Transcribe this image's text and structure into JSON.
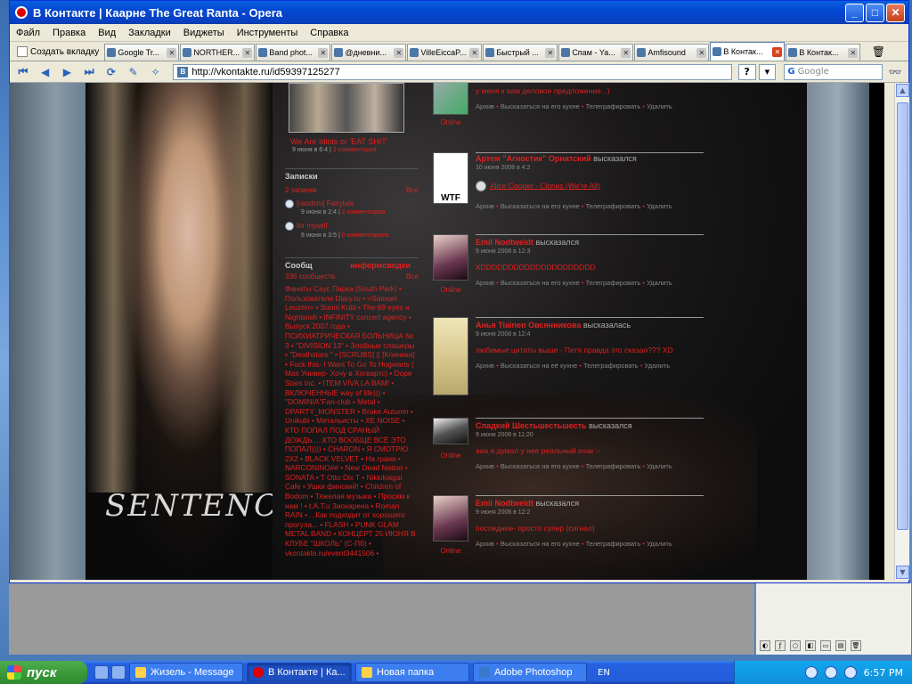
{
  "window": {
    "title": "В Контакте | Каарне The Great Ranta - Opera"
  },
  "menu": [
    "Файл",
    "Правка",
    "Вид",
    "Закладки",
    "Виджеты",
    "Инструменты",
    "Справка"
  ],
  "tabs": {
    "new_tab_label": "Создать вкладку",
    "items": [
      {
        "label": "Google Tr...",
        "active": false
      },
      {
        "label": "NORTHER...",
        "active": false
      },
      {
        "label": "Band phot...",
        "active": false
      },
      {
        "label": "@дневни...",
        "active": false
      },
      {
        "label": "VilleEiccaP...",
        "active": false
      },
      {
        "label": "Быстрый ...",
        "active": false
      },
      {
        "label": "Спам - Ya...",
        "active": false
      },
      {
        "label": "Amfisound",
        "active": false
      },
      {
        "label": "В Контак...",
        "active": true
      },
      {
        "label": "В Контак...",
        "active": false
      }
    ]
  },
  "address": {
    "url": "http://vkontakte.ru/id59397125277",
    "site_icon": "B",
    "search_placeholder": "Google",
    "search_brand": "G"
  },
  "page": {
    "photo_caption": "We Are Idiots or 'EAT SHIT'",
    "photo_meta_date": "9 июня в 6:4",
    "photo_meta_comments": "3 комментария",
    "notes_header": "Записки",
    "notes_count": "2 записки.",
    "notes_all": "Все",
    "notes": [
      {
        "title": "[random] Fairytale",
        "date": "9 июня в 2:4",
        "comments": "2 комментария"
      },
      {
        "title": "for myself",
        "date": "8 июня в 3:5",
        "comments": "0 комментариев"
      }
    ],
    "communities_header": "Сообщ",
    "communities_title": "информсводки",
    "communities_count": "336 сообществ.",
    "communities_all": "Все",
    "communities_text": "Фанаты Саус Парка (South Park) • Пользователи Diary.ru • =Samuel Leuzen= • Suoni Kubi • The 69 eyes и Nightwish • INFINITY concert agency • Выпуск 2007 года • ПСИХИАТРИЧЕСКАЯ БОЛЬНИЦА № 3 • \"DIVISION 13\" • Злобные слэшеры • \"Deathstars \" • [SCRUBS] || [Клиника] • Fuck this- I Want To Go To Hogwarts ( Max Универ- Хочу в Хогвартс) • Dope Stars Inc. • ITEM VIVA LA BAM! • ВКЛЮЧЕННЫЕ way of life))) • \"DOMINIA\"Fan-club • Metal • DPARTY_MONSTER • Brake Autumn • Unikubi • Метальисты • XE NOISE • КТО ПОПАЛ ПОД СРАНЫЙ ДОЖДЬ.....КТО ВООБЩЕ ВСЁ ЭТО ПОПАЛ)))) • CHARON • Я СМОТРЮ 2X2 • BLACK VELVET • На грани • NARCONINO## • New Dead Nation • SONATA • T Otto Dix T • Nikkikaigai Cafe • Ушки финский! • Children of Bodom • Тяжелая музыка • Просим к нам ! • t.A.T.u Заохарена • Roman RAIN • ...Как подходит от хорошего прогула... • FLASH • PUNK GLAM METAL BAND • КОНЦЕРТ 25 ИЮНЯ В КЛУБЕ \"ШКОЛЬ\" (С-Пб) • vkontakte.ru/event3441506 •"
  },
  "feed": [
    {
      "name": "",
      "verb": "",
      "date": "",
      "text": "у меня к вам деловое предложение...)",
      "actions": [
        "Архив",
        "Высказаться на его кухне",
        "Телеграфировать",
        "Удалить"
      ],
      "online": "Online"
    },
    {
      "name": "Артем \"Агностик\" Орнатский",
      "verb": "высказался",
      "date": "10 июня 2008 в 4:2",
      "text": "",
      "music": "Alice Cooper - Clones (We're All)",
      "actions": [
        "Архив",
        "Высказаться на его кухне",
        "Телеграфировать",
        "Удалить"
      ],
      "online": ""
    },
    {
      "name": "Emil Nodtweidt",
      "verb": "высказался",
      "date": "9 июня 2008 в 12:3",
      "text": "XDDDDDDDDDDDDDDDDDDDDD",
      "actions": [
        "Архив",
        "Высказаться на его кухне",
        "Телеграфировать",
        "Удалить"
      ],
      "online": "Online"
    },
    {
      "name": "Анья Tiainen Овсянникова",
      "verb": "высказалась",
      "date": "9 июня 2008 в 12:4",
      "text": "любимые цитаты выше - Петя правда это сказал??? XD",
      "actions": [
        "Архив",
        "Высказаться на её кухне",
        "Телеграфировать",
        "Удалить"
      ],
      "online": ""
    },
    {
      "name": "Сладкий Шестьшестьшесть",
      "verb": "высказался",
      "date": "9 июня 2008 в 11:20",
      "text": "ааа я думал у нее реальный ихак :-",
      "actions": [
        "Архив",
        "Высказаться на его кухне",
        "Телеграфировать",
        "Удалить"
      ],
      "online": "Online"
    },
    {
      "name": "Emil Nodtweidt",
      "verb": "высказался",
      "date": "9 июня 2008 в 12:2",
      "text": "последние- просто супер (сигнал)",
      "actions": [
        "Архив",
        "Высказаться на его кухне",
        "Телеграфировать",
        "Удалить"
      ],
      "online": "Online"
    }
  ],
  "taskbar": {
    "start_label": "пуск",
    "tasks": [
      {
        "label": "Жизель - Message",
        "active": false
      },
      {
        "label": "В Контакте | Ка...",
        "active": true
      },
      {
        "label": "Новая папка",
        "active": false
      },
      {
        "label": "Adobe Photoshop",
        "active": false
      }
    ],
    "lang": "EN",
    "clock": "6:57 PM"
  },
  "colors": {
    "link_red": "#e02020",
    "title_blue": "#0348d2",
    "taskbar_blue": "#245ddb"
  }
}
